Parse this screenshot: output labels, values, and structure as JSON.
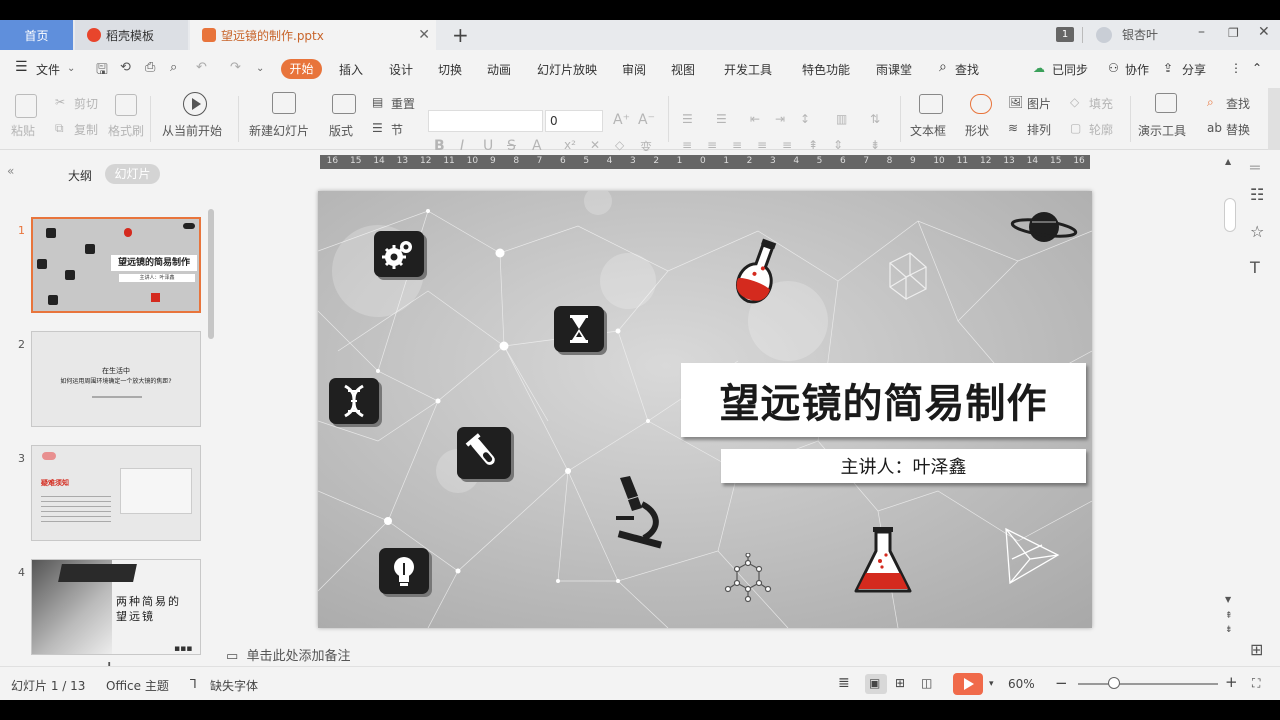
{
  "tabs": {
    "home": "首页",
    "template": "稻壳模板",
    "document": "望远镜的制作.pptx",
    "user": "银杏叶",
    "badge": "1"
  },
  "menu": {
    "file": "文件",
    "items": [
      "开始",
      "插入",
      "设计",
      "切换",
      "动画",
      "幻灯片放映",
      "审阅",
      "视图",
      "开发工具",
      "特色功能",
      "雨课堂"
    ],
    "search": "查找",
    "synced": "已同步",
    "collab": "协作",
    "share": "分享"
  },
  "ribbon": {
    "paste": "粘贴",
    "cut": "剪切",
    "copy": "复制",
    "format_painter": "格式刷",
    "from_current": "从当前开始",
    "new_slide": "新建幻灯片",
    "layout": "版式",
    "reset": "重置",
    "section": "节",
    "font_size": "0",
    "textbox": "文本框",
    "shape": "形状",
    "picture": "图片",
    "fill": "填充",
    "arrange": "排列",
    "outline": "轮廓",
    "presenter_tools": "演示工具",
    "find": "查找",
    "replace": "替换"
  },
  "left_panel": {
    "outline_tab": "大纲",
    "slides_tab": "幻灯片",
    "thumbs": [
      {
        "num": "1",
        "title": "望远镜的简易制作",
        "sub": "主讲人：叶泽鑫"
      },
      {
        "num": "2",
        "title": "在生活中",
        "sub": "如何运用周围环境确定一个放大镜的焦距?"
      },
      {
        "num": "3",
        "title": "疑难须知"
      },
      {
        "num": "4",
        "title": "两种简易的望远镜"
      }
    ]
  },
  "slide": {
    "title": "望远镜的简易制作",
    "subtitle": "主讲人：叶泽鑫"
  },
  "ruler_labels": [
    "16",
    "15",
    "14",
    "13",
    "12",
    "11",
    "10",
    "9",
    "8",
    "7",
    "6",
    "5",
    "4",
    "3",
    "2",
    "1",
    "0",
    "1",
    "2",
    "3",
    "4",
    "5",
    "6",
    "7",
    "8",
    "9",
    "10",
    "11",
    "12",
    "13",
    "14",
    "15",
    "16"
  ],
  "notes_placeholder": "单击此处添加备注",
  "status": {
    "slide_counter": "幻灯片 1 / 13",
    "theme": "Office 主题",
    "missing_font": "缺失字体",
    "zoom": "60%"
  },
  "colors": {
    "accent": "#e8743b",
    "home_tab": "#5f8fdc",
    "play": "#f06a4a",
    "flask_red": "#d42a1e"
  }
}
